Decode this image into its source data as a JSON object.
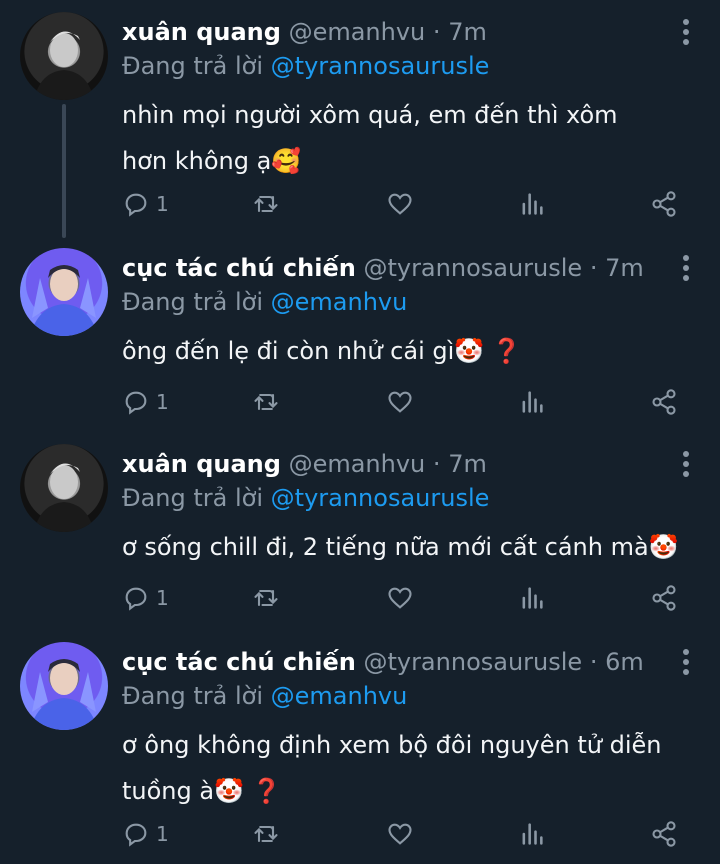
{
  "tweets": [
    {
      "name": "xuân quang",
      "handle": "@emanhvu",
      "sep": "·",
      "time": "7m",
      "reply_prefix": "Đang trả lời",
      "reply_to": "@tyrannosaurusle",
      "text": "nhìn mọi người xôm quá, em đến thì xôm hơn không ạ🥰",
      "reply_count": "1",
      "avatar_style": "dark"
    },
    {
      "name": "cục tác chú chiến",
      "handle": "@tyrannosaurusle",
      "sep": "·",
      "time": "7m",
      "reply_prefix": "Đang trả lời",
      "reply_to": "@emanhvu",
      "text": "ông đến lẹ đi còn nhử cái gì🤡 ❓",
      "reply_count": "1",
      "avatar_style": "blue"
    },
    {
      "name": "xuân quang",
      "handle": "@emanhvu",
      "sep": "·",
      "time": "7m",
      "reply_prefix": "Đang trả lời",
      "reply_to": "@tyrannosaurusle",
      "text": "ơ sống chill đi, 2 tiếng nữa mới cất cánh mà🤡",
      "reply_count": "1",
      "avatar_style": "dark"
    },
    {
      "name": "cục tác chú chiến",
      "handle": "@tyrannosaurusle",
      "sep": "·",
      "time": "6m",
      "reply_prefix": "Đang trả lời",
      "reply_to": "@emanhvu",
      "text": "ơ ông không định xem bộ đôi nguyên tử diễn tuồng à🤡 ❓",
      "reply_count": "1",
      "avatar_style": "blue"
    }
  ],
  "icons": {
    "reply": "reply-icon",
    "retweet": "retweet-icon",
    "like": "heart-icon",
    "analytics": "analytics-icon",
    "share": "share-icon",
    "more": "more-vertical-icon"
  },
  "colors": {
    "background": "#15202b",
    "muted": "#8b98a5",
    "link": "#1d9bf0",
    "thread_line": "#3a4756"
  }
}
